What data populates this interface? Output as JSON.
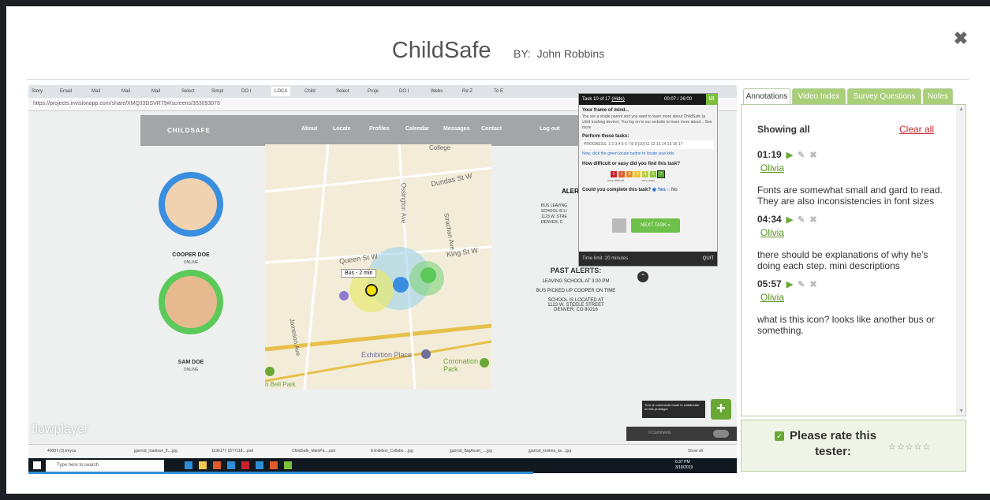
{
  "header": {
    "title": "ChildSafe",
    "by_label": "BY:",
    "author": "John Robbins",
    "close_glyph": "✖"
  },
  "video": {
    "browser_tabs": [
      "Story",
      "Email",
      "Mail",
      "Mail",
      "Mail",
      "Select",
      "Simpl",
      "DO I",
      "LOCA",
      "Child",
      "Select",
      "Proje",
      "DO I",
      "Webs",
      "Re:Z",
      "To E"
    ],
    "address": "https://projects.invisionapp.com/share/XMQJ3DSVR79#/screens/353093076",
    "site": {
      "logo": "CHILDSAFE",
      "nav": [
        "About",
        "Locate",
        "Profiles",
        "Calendar",
        "Messages",
        "Contact",
        "Log out"
      ]
    },
    "children": [
      {
        "name": "COOPER DOE",
        "status": "ONLINE"
      },
      {
        "name": "SAM DOE",
        "status": "ONLINE"
      }
    ],
    "map": {
      "streets": [
        "Dundas St W",
        "Queen St W",
        "King St W",
        "Ossington Ave",
        "Strachan Ave",
        "Jameson Ave",
        "Exhibition Place",
        "Coronation Park",
        "College"
      ],
      "bus_label": "Bus - 2 min",
      "park_label": "n Bell Park"
    },
    "alerts": {
      "alert_title": "ALER",
      "current": [
        "BUS LEAVING",
        "SCHOOL IS LI",
        "1123 W. STRE",
        "DENVER, C"
      ],
      "past_title": "PAST ALERTS:",
      "past": [
        "LEAVING SCHOOL AT 3:00 PM",
        "BUS PICKED UP COOPER ON TIME",
        "SCHOOL IS LOCATED AT",
        "1123 W. STEELE STREET",
        "DENVER, CO 80216"
      ]
    },
    "task": {
      "header": "Task 10 of 17",
      "header_link": "(Hide)",
      "rec_time": "00:07 / 26:00",
      "ui_badge": "UI",
      "frame_title": "Your frame of mind...",
      "frame_text": "You are a single parent and you want to learn more about ChildSafe (a child tracking device). You log on to our website to learn more about... See more",
      "perform_title": "Perform these tasks:",
      "progress": "PROGRESS: 1 2 3 4 5 6 7 8 9 [10] 11 12 13 14 15 16 17",
      "task_text": "Now, click the green locate button to locate your kids",
      "difficulty_q": "How difficult or easy did you find this task?",
      "rating_values": [
        "1",
        "2",
        "3",
        "4",
        "5",
        "6",
        "7"
      ],
      "rating_low": "very difficult",
      "rating_high": "very easy",
      "complete_q": "Could you complete this task?",
      "yes": "Yes",
      "no": "No",
      "next_label": "NEXT TASK »",
      "time_left": "Time limit: 20 minutes",
      "quit_label": "QUIT"
    },
    "flowplayer": "flowplayer",
    "comments_popup": "Turn on comments mode to collaborate on this prototype",
    "comments_toggle": "0 Comments",
    "downloads": [
      "40007 (3).tmyou",
      "jgarrod_madison_fl....jpg",
      "1136177 1577118....psd",
      "ChildSafe_MainPa....psd",
      "Exhibition_Collabo....jpg",
      "jgarrod_flagAsset_....jpg",
      "jgarrod_kristina_av....jpg"
    ],
    "show_all": "Show all",
    "taskbar": {
      "search": "Type here to search",
      "time": "6:37 PM",
      "date": "3/18/2019"
    }
  },
  "panel": {
    "tabs": [
      "Annotations",
      "Video Index",
      "Survey Questions",
      "Notes"
    ],
    "showing": "Showing all",
    "clear_all": "Clear all",
    "annotations": [
      {
        "time": "01:19",
        "user": "Olivia",
        "text": "Fonts are somewhat small and gard to read. They are also inconsistencies in font sizes"
      },
      {
        "time": "04:34",
        "user": "Olivia",
        "text": "there should be explanations of why he's doing each step. mini descriptions"
      },
      {
        "time": "05:57",
        "user": "Olivia",
        "text": "what is this icon? looks like another bus or something."
      }
    ],
    "rate_label": "Please rate this tester:",
    "stars": "☆☆☆☆☆",
    "plus": "+"
  },
  "colors": {
    "accent_green": "#6aa835",
    "tab_green": "#a9cf78",
    "clear_red": "#c8232c",
    "progress_blue": "#2f8fd6"
  }
}
